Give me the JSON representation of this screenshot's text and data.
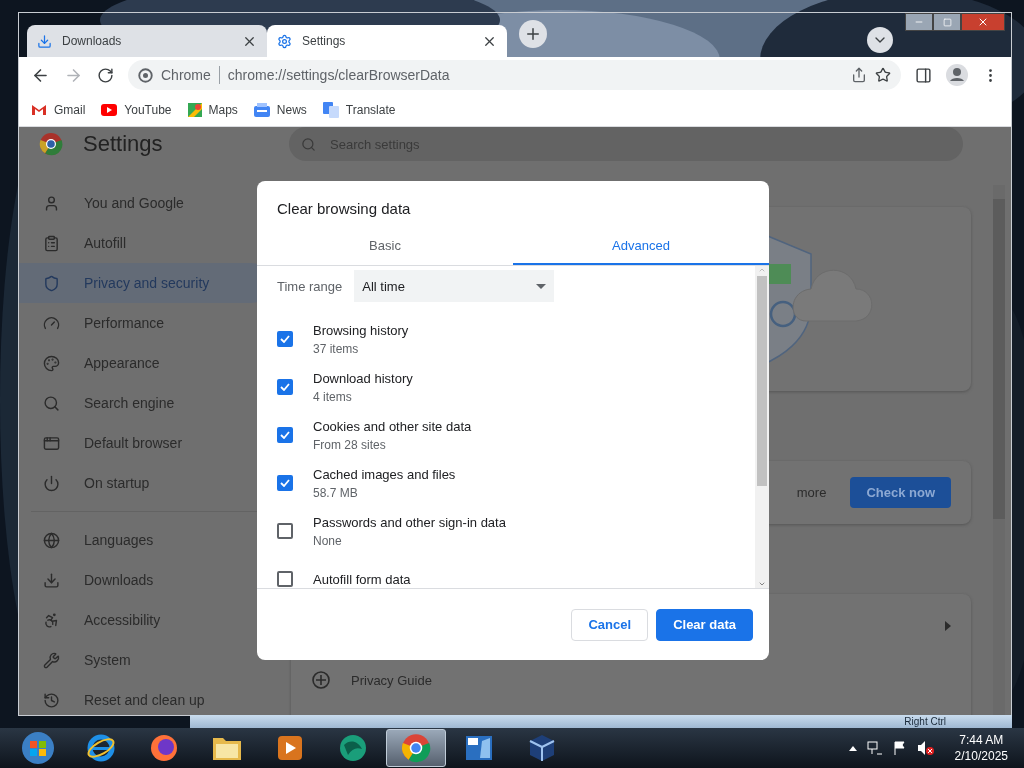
{
  "tabs": [
    {
      "label": "Downloads",
      "selected": false
    },
    {
      "label": "Settings",
      "selected": true
    }
  ],
  "toolbar": {
    "origin_chip": "Chrome",
    "url": "chrome://settings/clearBrowserData"
  },
  "bookmarks": [
    "Gmail",
    "YouTube",
    "Maps",
    "News",
    "Translate"
  ],
  "settings": {
    "title": "Settings",
    "search_placeholder": "Search settings",
    "nav_sections": [
      {
        "items": [
          {
            "label": "You and Google",
            "selected": false
          },
          {
            "label": "Autofill",
            "selected": false
          },
          {
            "label": "Privacy and security",
            "selected": true
          },
          {
            "label": "Performance",
            "selected": false
          },
          {
            "label": "Appearance",
            "selected": false
          },
          {
            "label": "Search engine",
            "selected": false
          },
          {
            "label": "Default browser",
            "selected": false
          },
          {
            "label": "On startup",
            "selected": false
          }
        ]
      },
      {
        "items": [
          {
            "label": "Languages",
            "selected": false
          },
          {
            "label": "Downloads",
            "selected": false
          },
          {
            "label": "Accessibility",
            "selected": false
          },
          {
            "label": "System",
            "selected": false
          },
          {
            "label": "Reset and clean up",
            "selected": false
          }
        ]
      }
    ],
    "safety_text": "more",
    "check_button": "Check now",
    "privacy_guide": "Privacy Guide"
  },
  "dialog": {
    "title": "Clear browsing data",
    "tabs": [
      {
        "label": "Basic",
        "selected": false
      },
      {
        "label": "Advanced",
        "selected": true
      }
    ],
    "time_range": {
      "label": "Time range",
      "value": "All time"
    },
    "items": [
      {
        "label": "Browsing history",
        "detail": "37 items",
        "checked": true
      },
      {
        "label": "Download history",
        "detail": "4 items",
        "checked": true
      },
      {
        "label": "Cookies and other site data",
        "detail": "From 28 sites",
        "checked": true
      },
      {
        "label": "Cached images and files",
        "detail": "58.7 MB",
        "checked": true
      },
      {
        "label": "Passwords and other sign-in data",
        "detail": "None",
        "checked": false
      },
      {
        "label": "Autofill form data",
        "checked": false
      }
    ],
    "buttons": [
      {
        "label": "Cancel",
        "kind": "secondary"
      },
      {
        "label": "Clear data",
        "kind": "primary"
      }
    ]
  },
  "vm_status": {
    "host_key": "Right Ctrl"
  },
  "taskbar": {
    "apps": [
      {
        "selected": false
      },
      {
        "selected": false
      },
      {
        "selected": false
      },
      {
        "selected": false
      },
      {
        "selected": false
      },
      {
        "selected": true
      },
      {
        "selected": false
      },
      {
        "selected": false
      }
    ]
  },
  "clock": {
    "time": "7:44 AM",
    "date": "2/10/2025"
  }
}
